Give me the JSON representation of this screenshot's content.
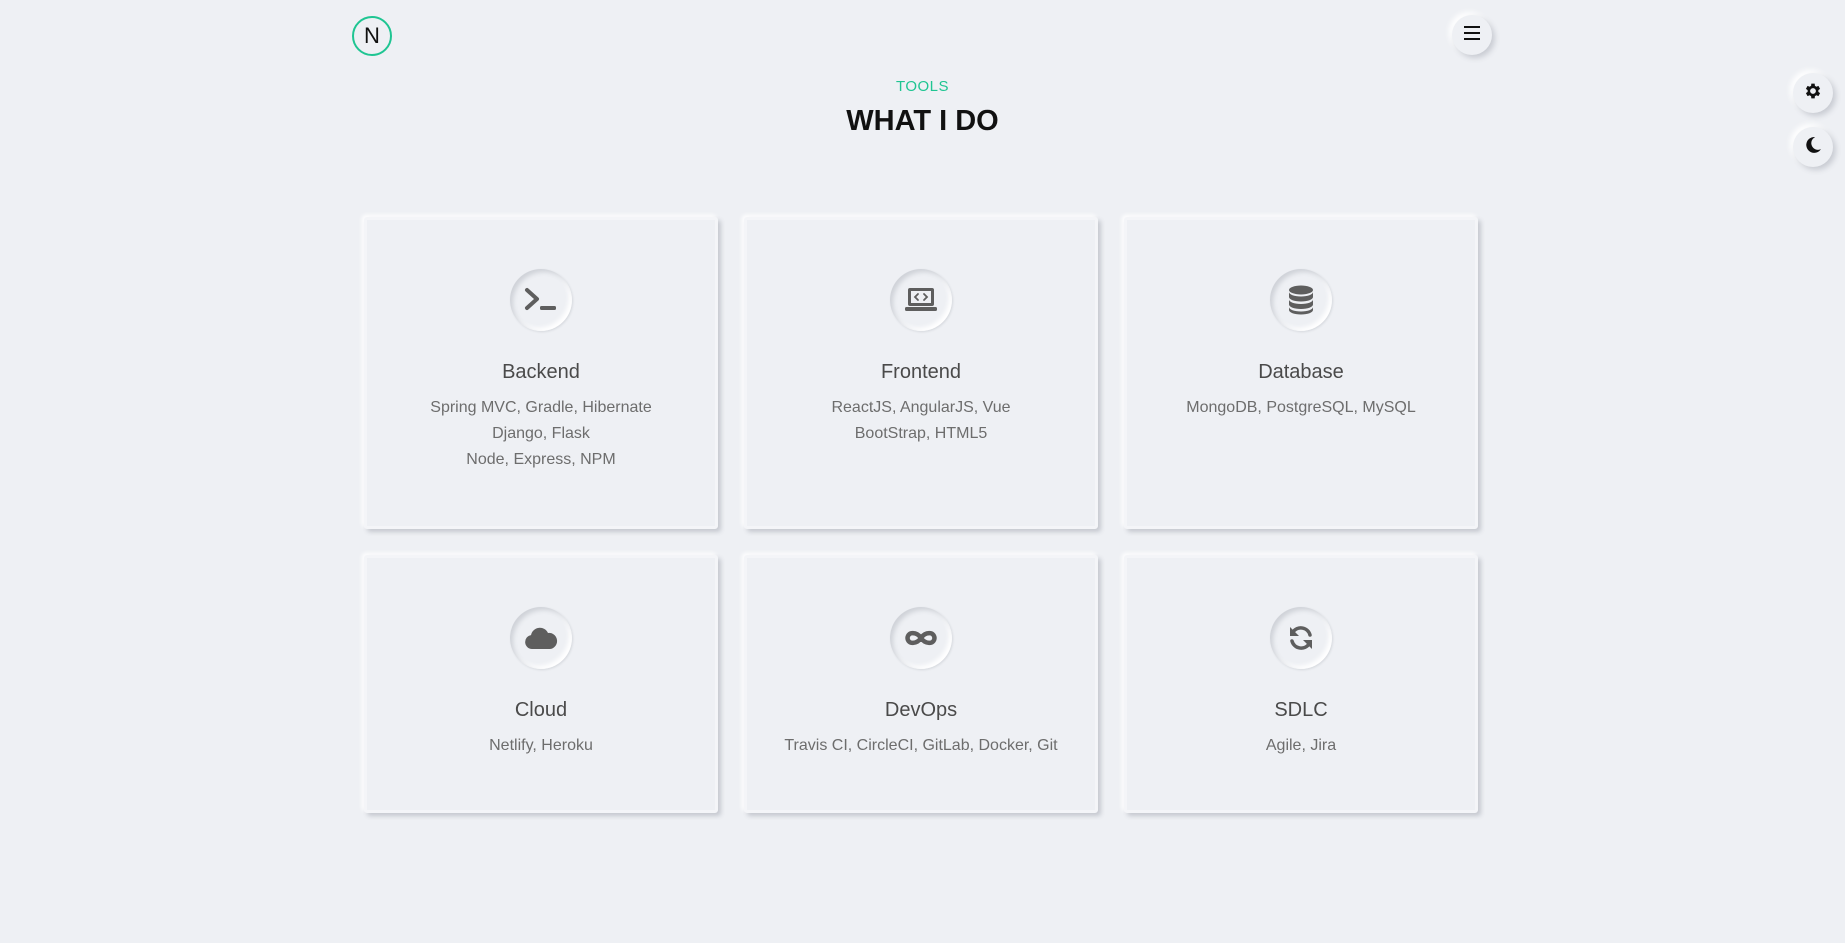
{
  "header": {
    "logo_letter": "N"
  },
  "section": {
    "eyebrow": "TOOLS",
    "heading": "WHAT I DO"
  },
  "cards": [
    {
      "title": "Backend",
      "icon": "terminal-icon",
      "lines": [
        "Spring MVC, Gradle, Hibernate",
        "Django, Flask",
        "Node, Express, NPM"
      ]
    },
    {
      "title": "Frontend",
      "icon": "laptop-code-icon",
      "lines": [
        "ReactJS, AngularJS, Vue",
        "BootStrap, HTML5"
      ]
    },
    {
      "title": "Database",
      "icon": "database-icon",
      "lines": [
        "MongoDB, PostgreSQL, MySQL"
      ]
    },
    {
      "title": "Cloud",
      "icon": "cloud-icon",
      "lines": [
        "Netlify, Heroku"
      ]
    },
    {
      "title": "DevOps",
      "icon": "infinity-icon",
      "lines": [
        "Travis CI, CircleCI, GitLab, Docker, Git"
      ]
    },
    {
      "title": "SDLC",
      "icon": "sync-icon",
      "lines": [
        "Agile, Jira"
      ]
    }
  ],
  "colors": {
    "accent": "#1fc592",
    "background": "#eef0f4",
    "icon": "#5e5e5e"
  }
}
